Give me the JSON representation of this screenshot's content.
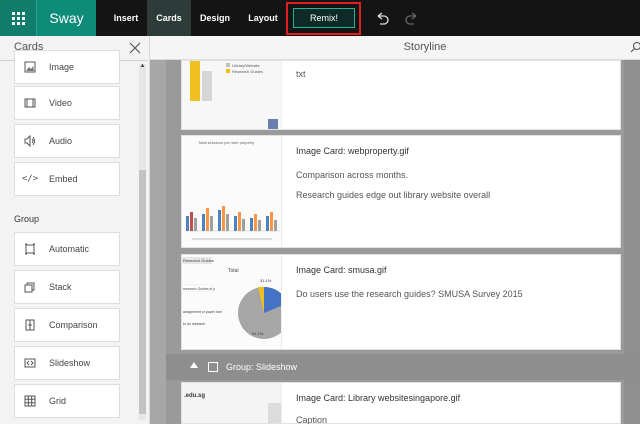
{
  "app": {
    "brand": "Sway",
    "nav": {
      "insert": "Insert",
      "cards": "Cards",
      "design": "Design",
      "layout": "Layout"
    },
    "remix_label": "Remix!"
  },
  "cards_panel": {
    "title": "Cards",
    "items_media": [
      {
        "label": "Image",
        "icon": "image-icon"
      },
      {
        "label": "Video",
        "icon": "video-icon"
      },
      {
        "label": "Audio",
        "icon": "audio-icon"
      },
      {
        "label": "Embed",
        "icon": "embed-icon"
      }
    ],
    "group_heading": "Group",
    "items_group": [
      {
        "label": "Automatic",
        "icon": "automatic-icon"
      },
      {
        "label": "Stack",
        "icon": "stack-icon"
      },
      {
        "label": "Comparison",
        "icon": "comparison-icon"
      },
      {
        "label": "Slideshow",
        "icon": "slideshow-icon"
      },
      {
        "label": "Grid",
        "icon": "grid-icon"
      }
    ]
  },
  "storyline": {
    "title": "Storyline",
    "cards": [
      {
        "title": "",
        "lines": [
          "txt"
        ]
      },
      {
        "title": "Image Card: webproperty.gif",
        "lines": [
          "Comparison across months.",
          "Research guides edge out library website overall"
        ]
      },
      {
        "title": "Image Card: smusa.gif",
        "lines": [
          "Do users use the research guides? SMUSA Survey 2015"
        ]
      },
      {
        "title": "Image Card: Library websitesingapore.gif",
        "lines": [
          "Caption"
        ]
      }
    ],
    "group_bar": {
      "label": "Group: Slideshow"
    },
    "thumb_texts": {
      "legend_library": "Library/Website",
      "legend_research": "Research Guides",
      "chart_title": "Total sessions per web property",
      "research_guides_tag": "Research Guides",
      "pie_title": "Total",
      "slice_a": "31.1%",
      "slice_b": "51.1%",
      "legend_row_1": "research Guides in y",
      "legend_row_2": "assignment or paper due",
      "legend_row_3": "to do research",
      "edu_text": ".edu.sg"
    }
  }
}
